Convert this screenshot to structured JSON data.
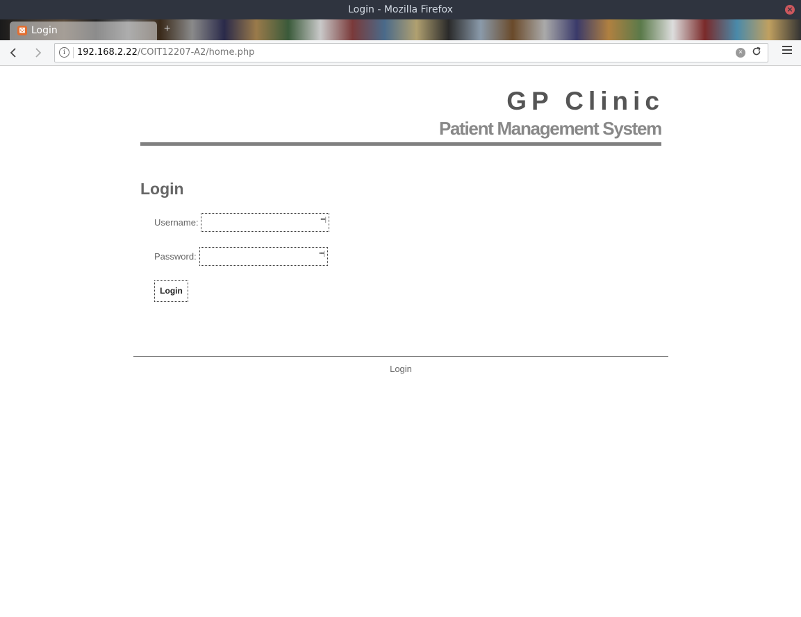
{
  "window": {
    "title": "Login - Mozilla Firefox"
  },
  "tabs": [
    {
      "label": "Login"
    }
  ],
  "navbar": {
    "url_host": "192.168.2.22",
    "url_path": "/COIT12207-A2/home.php"
  },
  "site": {
    "title": "GP Clinic",
    "subtitle": "Patient Management System"
  },
  "login": {
    "heading": "Login",
    "username_label": "Username:",
    "username_value": "",
    "password_label": "Password:",
    "password_value": "",
    "submit_label": "Login"
  },
  "footer": {
    "text": "Login"
  },
  "icons": {
    "window_close": "close-icon",
    "tab_favicon": "xampp-icon",
    "new_tab": "plus-icon",
    "back": "arrow-left-icon",
    "forward": "arrow-right-icon",
    "site_info": "info-icon",
    "clear_url": "clear-icon",
    "reload": "reload-icon",
    "menu": "hamburger-icon",
    "password_manager": "key-icon"
  }
}
